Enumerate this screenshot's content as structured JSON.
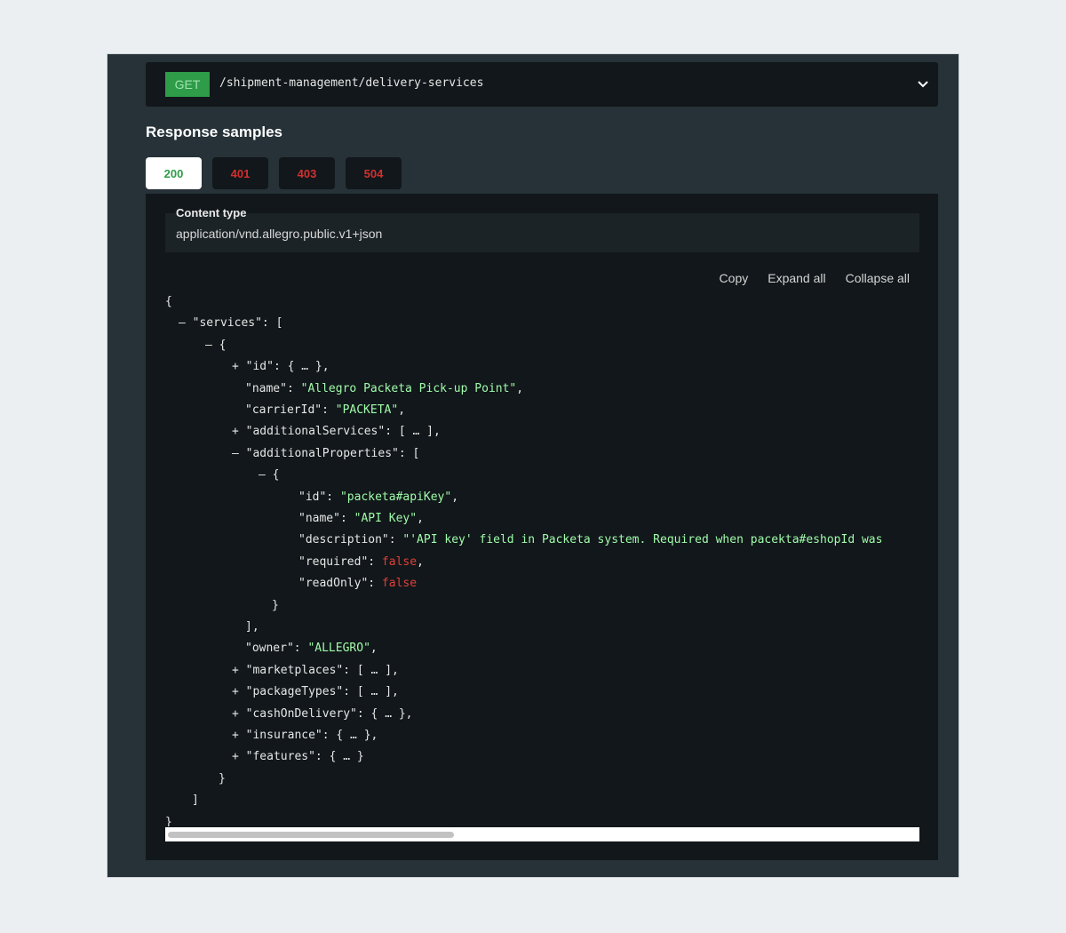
{
  "endpoint": {
    "method": "GET",
    "path": "/shipment-management/delivery-services",
    "chevron_icon": "chevron-down-icon"
  },
  "response": {
    "heading": "Response samples",
    "tabs": [
      {
        "label": "200",
        "active": true
      },
      {
        "label": "401",
        "active": false
      },
      {
        "label": "403",
        "active": false
      },
      {
        "label": "504",
        "active": false
      }
    ],
    "content_type_label": "Content type",
    "content_type_value": "application/vnd.allegro.public.v1+json",
    "actions": {
      "copy": "Copy",
      "expand_all": "Expand all",
      "collapse_all": "Collapse all"
    }
  },
  "code_lines": [
    {
      "indent": 0,
      "toggle": "",
      "key": "",
      "value": "{",
      "value_type": "punct"
    },
    {
      "indent": 1,
      "toggle": "–",
      "key": "\"services\": ",
      "value": "[",
      "value_type": "punct"
    },
    {
      "indent": 3,
      "toggle": "–",
      "key": "",
      "value": "{",
      "value_type": "punct"
    },
    {
      "indent": 5,
      "toggle": "+",
      "key": "\"id\": ",
      "value": "{ … },",
      "value_type": "punct"
    },
    {
      "indent": 6,
      "toggle": "",
      "key": "\"name\": ",
      "value": "\"Allegro Packeta Pick-up Point\"",
      "value_type": "string",
      "suffix": ","
    },
    {
      "indent": 6,
      "toggle": "",
      "key": "\"carrierId\": ",
      "value": "\"PACKETA\"",
      "value_type": "string",
      "suffix": ","
    },
    {
      "indent": 5,
      "toggle": "+",
      "key": "\"additionalServices\": ",
      "value": "[ … ],",
      "value_type": "punct"
    },
    {
      "indent": 5,
      "toggle": "–",
      "key": "\"additionalProperties\": ",
      "value": "[",
      "value_type": "punct"
    },
    {
      "indent": 7,
      "toggle": "–",
      "key": "",
      "value": "{",
      "value_type": "punct"
    },
    {
      "indent": 10,
      "toggle": "",
      "key": "\"id\": ",
      "value": "\"packeta#apiKey\"",
      "value_type": "string",
      "suffix": ","
    },
    {
      "indent": 10,
      "toggle": "",
      "key": "\"name\": ",
      "value": "\"API Key\"",
      "value_type": "string",
      "suffix": ","
    },
    {
      "indent": 10,
      "toggle": "",
      "key": "\"description\": ",
      "value": "\"'API key' field in Packeta system. Required when pacekta#eshopId was",
      "value_type": "string",
      "suffix": ""
    },
    {
      "indent": 10,
      "toggle": "",
      "key": "\"required\": ",
      "value": "false",
      "value_type": "false",
      "suffix": ","
    },
    {
      "indent": 10,
      "toggle": "",
      "key": "\"readOnly\": ",
      "value": "false",
      "value_type": "false",
      "suffix": ""
    },
    {
      "indent": 8,
      "toggle": "",
      "key": "",
      "value": "}",
      "value_type": "punct"
    },
    {
      "indent": 6,
      "toggle": "",
      "key": "",
      "value": "],",
      "value_type": "punct"
    },
    {
      "indent": 6,
      "toggle": "",
      "key": "\"owner\": ",
      "value": "\"ALLEGRO\"",
      "value_type": "string",
      "suffix": ","
    },
    {
      "indent": 5,
      "toggle": "+",
      "key": "\"marketplaces\": ",
      "value": "[ … ],",
      "value_type": "punct"
    },
    {
      "indent": 5,
      "toggle": "+",
      "key": "\"packageTypes\": ",
      "value": "[ … ],",
      "value_type": "punct"
    },
    {
      "indent": 5,
      "toggle": "+",
      "key": "\"cashOnDelivery\": ",
      "value": "{ … },",
      "value_type": "punct"
    },
    {
      "indent": 5,
      "toggle": "+",
      "key": "\"insurance\": ",
      "value": "{ … },",
      "value_type": "punct"
    },
    {
      "indent": 5,
      "toggle": "+",
      "key": "\"features\": ",
      "value": "{ … }",
      "value_type": "punct"
    },
    {
      "indent": 4,
      "toggle": "",
      "key": "",
      "value": "}",
      "value_type": "punct"
    },
    {
      "indent": 2,
      "toggle": "",
      "key": "",
      "value": "]",
      "value_type": "punct"
    },
    {
      "indent": 0,
      "toggle": "",
      "key": "",
      "value": "}",
      "value_type": "punct"
    }
  ]
}
